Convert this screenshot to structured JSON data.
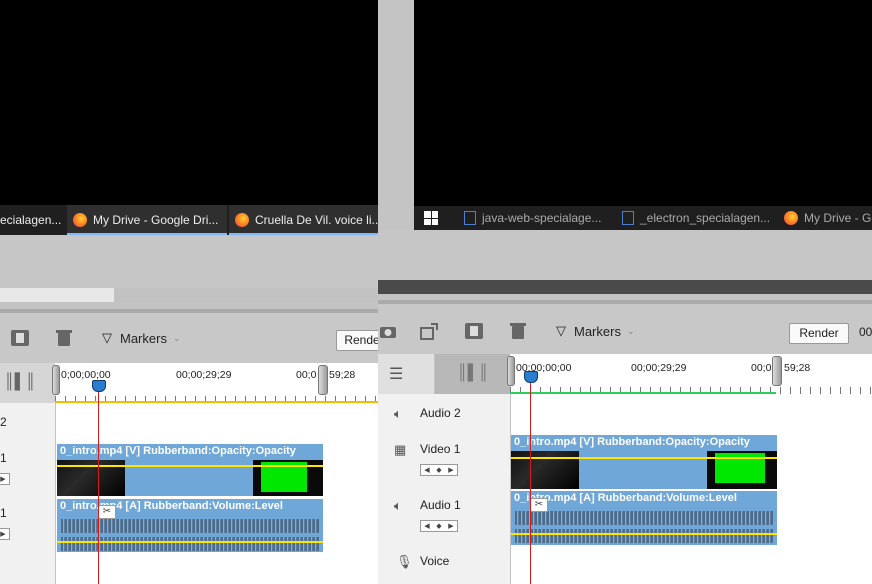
{
  "left": {
    "taskbar": {
      "items": [
        {
          "label": "ecialagen...",
          "icon": "app-icon"
        },
        {
          "label": "My Drive - Google Dri...",
          "icon": "firefox-icon"
        },
        {
          "label": "Cruella De Vil. voice li...",
          "icon": "firefox-icon"
        }
      ]
    },
    "toolbar": {
      "markers_label": "Markers",
      "render_label": "Rende"
    },
    "ruler": {
      "tc_start": "0;00;00;00",
      "tc_mid": "00;00;29;29",
      "tc_end": "00;0",
      "tc_end2": "59;28"
    },
    "tracks": {
      "audio2": "2",
      "video1": "1",
      "audio1": "1"
    },
    "clips": {
      "video": "0_intro.mp4 [V] Rubberband:Opacity:Opacity",
      "audio": "0_intro.mp4 [A] Rubberband:Volume:Level"
    }
  },
  "right": {
    "taskbar": {
      "items": [
        {
          "label": "java-web-specialage...",
          "icon": "app-icon"
        },
        {
          "label": "_electron_specialagen...",
          "icon": "app-icon"
        },
        {
          "label": "My Drive - G",
          "icon": "firefox-icon"
        }
      ]
    },
    "toolbar": {
      "markers_label": "Markers",
      "render_label": "Render",
      "extra": "00"
    },
    "ruler": {
      "tc_start": "00;00;00;00",
      "tc_mid": "00;00;29;29",
      "tc_end": "00;0",
      "tc_end2": "59;28"
    },
    "tracks": {
      "audio2": "Audio 2",
      "video1": "Video 1",
      "audio1": "Audio 1",
      "voice": "Voice"
    },
    "clips": {
      "video": "0_intro.mp4 [V] Rubberband:Opacity:Opacity",
      "audio": "0_intro.mp4 [A] Rubberband:Volume:Level"
    }
  },
  "colors": {
    "clip": "#6fa8d8",
    "rubberband": "#ffe600",
    "playhead": "#d41c1c",
    "green_bar": "#00e800"
  }
}
